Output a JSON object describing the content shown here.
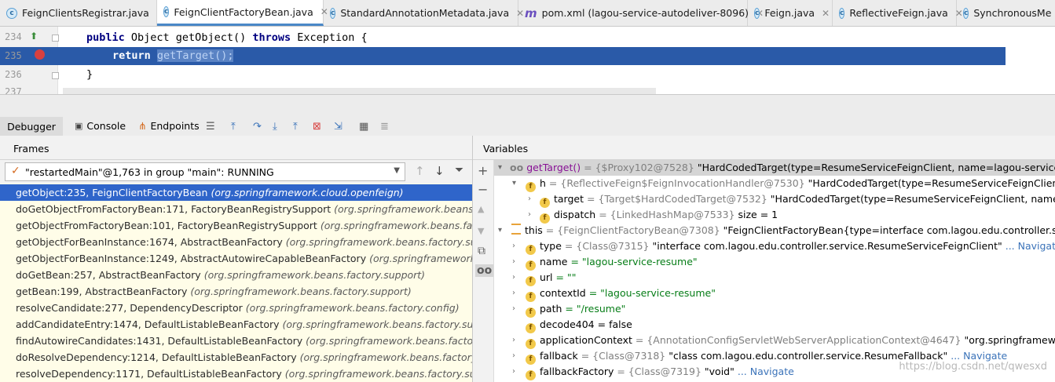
{
  "tabs": [
    {
      "label": "FeignClientsRegistrar.java",
      "icon": "java-class-icon",
      "active": false
    },
    {
      "label": "FeignClientFactoryBean.java",
      "icon": "java-class-icon",
      "active": true
    },
    {
      "label": "StandardAnnotationMetadata.java",
      "icon": "java-class-icon",
      "active": false
    },
    {
      "label": "pom.xml (lagou-service-autodeliver-8096)",
      "icon": "maven-icon",
      "active": false
    },
    {
      "label": "Feign.java",
      "icon": "java-class-icon",
      "active": false
    },
    {
      "label": "ReflectiveFeign.java",
      "icon": "java-class-icon",
      "active": false
    },
    {
      "label": "SynchronousMe",
      "icon": "java-class-icon",
      "active": false
    }
  ],
  "editor": {
    "lines": [
      {
        "num": "234",
        "kw1": "public",
        "text1": " Object getObject() ",
        "kw2": "throws",
        "text2": " Exception {"
      },
      {
        "num": "235",
        "kw1": "return",
        "call": "getTarget();"
      },
      {
        "num": "236",
        "text": "}"
      },
      {
        "num": "237"
      }
    ]
  },
  "debug_toolbar": {
    "debugger_tab": "Debugger",
    "console_tab": "Console",
    "endpoints_tab": "Endpoints"
  },
  "frames": {
    "header": "Frames",
    "thread": "\"restartedMain\"@1,763 in group \"main\": RUNNING",
    "items": [
      {
        "method": "getObject:235, FeignClientFactoryBean",
        "pkg": "(org.springframework.cloud.openfeign)"
      },
      {
        "method": "doGetObjectFromFactoryBean:171, FactoryBeanRegistrySupport",
        "pkg": "(org.springframework.beans.factory.support)"
      },
      {
        "method": "getObjectFromFactoryBean:101, FactoryBeanRegistrySupport",
        "pkg": "(org.springframework.beans.factory.support)"
      },
      {
        "method": "getObjectForBeanInstance:1674, AbstractBeanFactory",
        "pkg": "(org.springframework.beans.factory.support)"
      },
      {
        "method": "getObjectForBeanInstance:1249, AbstractAutowireCapableBeanFactory",
        "pkg": "(org.springframework.beans.factory.support)"
      },
      {
        "method": "doGetBean:257, AbstractBeanFactory",
        "pkg": "(org.springframework.beans.factory.support)"
      },
      {
        "method": "getBean:199, AbstractBeanFactory",
        "pkg": "(org.springframework.beans.factory.support)"
      },
      {
        "method": "resolveCandidate:277, DependencyDescriptor",
        "pkg": "(org.springframework.beans.factory.config)"
      },
      {
        "method": "addCandidateEntry:1474, DefaultListableBeanFactory",
        "pkg": "(org.springframework.beans.factory.support)"
      },
      {
        "method": "findAutowireCandidates:1431, DefaultListableBeanFactory",
        "pkg": "(org.springframework.beans.factory.support)"
      },
      {
        "method": "doResolveDependency:1214, DefaultListableBeanFactory",
        "pkg": "(org.springframework.beans.factory.support)"
      },
      {
        "method": "resolveDependency:1171, DefaultListableBeanFactory",
        "pkg": "(org.springframework.beans.factory.support)"
      }
    ]
  },
  "variables": {
    "header": "Variables",
    "rows": [
      {
        "name": "getTarget()",
        "type": "= {$Proxy102@7528}",
        "value": "\"HardCodedTarget(type=ResumeServiceFeignClient, name=lagou-service-resume,"
      },
      {
        "name": "h",
        "type": "= {ReflectiveFeign$FeignInvocationHandler@7530}",
        "value": "\"HardCodedTarget(type=ResumeServiceFeignClient, name=l"
      },
      {
        "name": "target",
        "type": "= {Target$HardCodedTarget@7532}",
        "value": "\"HardCodedTarget(type=ResumeServiceFeignClient, name=lagou-"
      },
      {
        "name": "dispatch",
        "type": "= {LinkedHashMap@7533}",
        "value": "size = 1"
      },
      {
        "name": "this",
        "type": "= {FeignClientFactoryBean@7308}",
        "value": "\"FeignClientFactoryBean{type=interface com.lagou.edu.controller.service.Resu"
      },
      {
        "name": "type",
        "type": "= {Class@7315}",
        "value": "\"interface com.lagou.edu.controller.service.ResumeServiceFeignClient\"",
        "nav": "... Navigate"
      },
      {
        "name": "name",
        "value": "= \"lagou-service-resume\""
      },
      {
        "name": "url",
        "value": "= \"\""
      },
      {
        "name": "contextId",
        "value": "= \"lagou-service-resume\""
      },
      {
        "name": "path",
        "value": "= \"/resume\""
      },
      {
        "name": "decode404",
        "value": "= false"
      },
      {
        "name": "applicationContext",
        "type": "= {AnnotationConfigServletWebServerApplicationContext@4647}",
        "value": "\"org.springframework.boot."
      },
      {
        "name": "fallback",
        "type": "= {Class@7318}",
        "value": "\"class com.lagou.edu.controller.service.ResumeFallback\"",
        "nav": "... Navigate"
      },
      {
        "name": "fallbackFactory",
        "type": "= {Class@7319}",
        "value": "\"void\"",
        "nav": "... Navigate"
      }
    ]
  },
  "watermark": "https://blog.csdn.net/qwesxd"
}
